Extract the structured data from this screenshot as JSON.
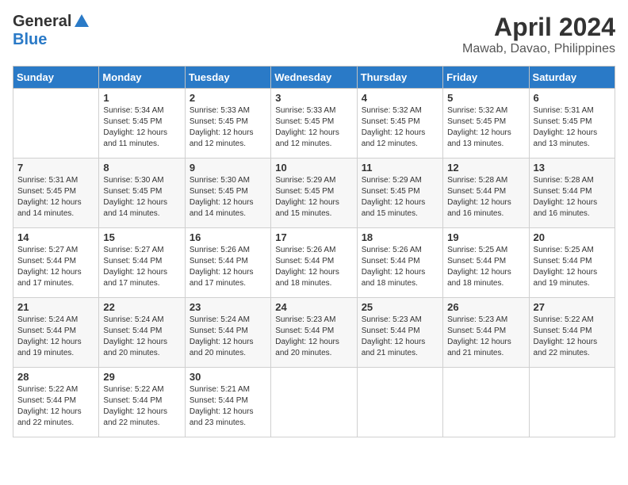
{
  "header": {
    "logo_general": "General",
    "logo_blue": "Blue",
    "month_title": "April 2024",
    "location": "Mawab, Davao, Philippines"
  },
  "weekdays": [
    "Sunday",
    "Monday",
    "Tuesday",
    "Wednesday",
    "Thursday",
    "Friday",
    "Saturday"
  ],
  "weeks": [
    [
      {
        "day": "",
        "info": ""
      },
      {
        "day": "1",
        "info": "Sunrise: 5:34 AM\nSunset: 5:45 PM\nDaylight: 12 hours\nand 11 minutes."
      },
      {
        "day": "2",
        "info": "Sunrise: 5:33 AM\nSunset: 5:45 PM\nDaylight: 12 hours\nand 12 minutes."
      },
      {
        "day": "3",
        "info": "Sunrise: 5:33 AM\nSunset: 5:45 PM\nDaylight: 12 hours\nand 12 minutes."
      },
      {
        "day": "4",
        "info": "Sunrise: 5:32 AM\nSunset: 5:45 PM\nDaylight: 12 hours\nand 12 minutes."
      },
      {
        "day": "5",
        "info": "Sunrise: 5:32 AM\nSunset: 5:45 PM\nDaylight: 12 hours\nand 13 minutes."
      },
      {
        "day": "6",
        "info": "Sunrise: 5:31 AM\nSunset: 5:45 PM\nDaylight: 12 hours\nand 13 minutes."
      }
    ],
    [
      {
        "day": "7",
        "info": "Sunrise: 5:31 AM\nSunset: 5:45 PM\nDaylight: 12 hours\nand 14 minutes."
      },
      {
        "day": "8",
        "info": "Sunrise: 5:30 AM\nSunset: 5:45 PM\nDaylight: 12 hours\nand 14 minutes."
      },
      {
        "day": "9",
        "info": "Sunrise: 5:30 AM\nSunset: 5:45 PM\nDaylight: 12 hours\nand 14 minutes."
      },
      {
        "day": "10",
        "info": "Sunrise: 5:29 AM\nSunset: 5:45 PM\nDaylight: 12 hours\nand 15 minutes."
      },
      {
        "day": "11",
        "info": "Sunrise: 5:29 AM\nSunset: 5:45 PM\nDaylight: 12 hours\nand 15 minutes."
      },
      {
        "day": "12",
        "info": "Sunrise: 5:28 AM\nSunset: 5:44 PM\nDaylight: 12 hours\nand 16 minutes."
      },
      {
        "day": "13",
        "info": "Sunrise: 5:28 AM\nSunset: 5:44 PM\nDaylight: 12 hours\nand 16 minutes."
      }
    ],
    [
      {
        "day": "14",
        "info": "Sunrise: 5:27 AM\nSunset: 5:44 PM\nDaylight: 12 hours\nand 17 minutes."
      },
      {
        "day": "15",
        "info": "Sunrise: 5:27 AM\nSunset: 5:44 PM\nDaylight: 12 hours\nand 17 minutes."
      },
      {
        "day": "16",
        "info": "Sunrise: 5:26 AM\nSunset: 5:44 PM\nDaylight: 12 hours\nand 17 minutes."
      },
      {
        "day": "17",
        "info": "Sunrise: 5:26 AM\nSunset: 5:44 PM\nDaylight: 12 hours\nand 18 minutes."
      },
      {
        "day": "18",
        "info": "Sunrise: 5:26 AM\nSunset: 5:44 PM\nDaylight: 12 hours\nand 18 minutes."
      },
      {
        "day": "19",
        "info": "Sunrise: 5:25 AM\nSunset: 5:44 PM\nDaylight: 12 hours\nand 18 minutes."
      },
      {
        "day": "20",
        "info": "Sunrise: 5:25 AM\nSunset: 5:44 PM\nDaylight: 12 hours\nand 19 minutes."
      }
    ],
    [
      {
        "day": "21",
        "info": "Sunrise: 5:24 AM\nSunset: 5:44 PM\nDaylight: 12 hours\nand 19 minutes."
      },
      {
        "day": "22",
        "info": "Sunrise: 5:24 AM\nSunset: 5:44 PM\nDaylight: 12 hours\nand 20 minutes."
      },
      {
        "day": "23",
        "info": "Sunrise: 5:24 AM\nSunset: 5:44 PM\nDaylight: 12 hours\nand 20 minutes."
      },
      {
        "day": "24",
        "info": "Sunrise: 5:23 AM\nSunset: 5:44 PM\nDaylight: 12 hours\nand 20 minutes."
      },
      {
        "day": "25",
        "info": "Sunrise: 5:23 AM\nSunset: 5:44 PM\nDaylight: 12 hours\nand 21 minutes."
      },
      {
        "day": "26",
        "info": "Sunrise: 5:23 AM\nSunset: 5:44 PM\nDaylight: 12 hours\nand 21 minutes."
      },
      {
        "day": "27",
        "info": "Sunrise: 5:22 AM\nSunset: 5:44 PM\nDaylight: 12 hours\nand 22 minutes."
      }
    ],
    [
      {
        "day": "28",
        "info": "Sunrise: 5:22 AM\nSunset: 5:44 PM\nDaylight: 12 hours\nand 22 minutes."
      },
      {
        "day": "29",
        "info": "Sunrise: 5:22 AM\nSunset: 5:44 PM\nDaylight: 12 hours\nand 22 minutes."
      },
      {
        "day": "30",
        "info": "Sunrise: 5:21 AM\nSunset: 5:44 PM\nDaylight: 12 hours\nand 23 minutes."
      },
      {
        "day": "",
        "info": ""
      },
      {
        "day": "",
        "info": ""
      },
      {
        "day": "",
        "info": ""
      },
      {
        "day": "",
        "info": ""
      }
    ]
  ]
}
